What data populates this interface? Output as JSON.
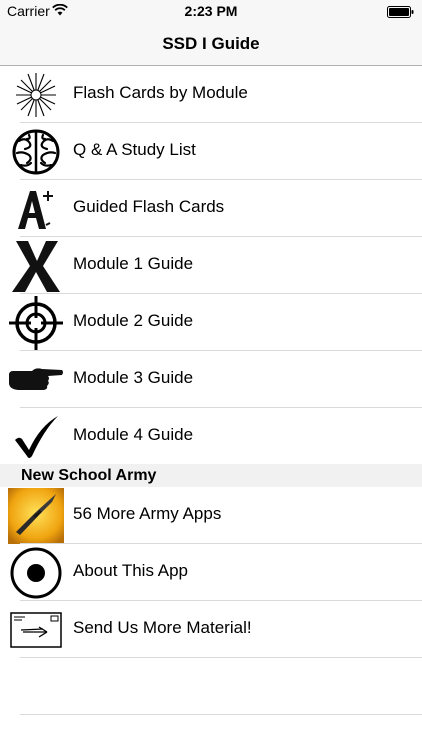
{
  "status_bar": {
    "carrier": "Carrier",
    "time": "2:23 PM"
  },
  "nav": {
    "title": "SSD I Guide"
  },
  "rows_group1": [
    {
      "label": "Flash Cards by Module",
      "icon": "starburst-icon"
    },
    {
      "label": "Q & A Study List",
      "icon": "brain-icon"
    },
    {
      "label": "Guided Flash Cards",
      "icon": "a-plus-icon"
    },
    {
      "label": "Module 1 Guide",
      "icon": "x-mark-icon"
    },
    {
      "label": "Module 2 Guide",
      "icon": "crosshair-icon"
    },
    {
      "label": "Module 3 Guide",
      "icon": "pointing-hand-icon"
    },
    {
      "label": "Module 4 Guide",
      "icon": "checkmark-icon"
    }
  ],
  "section": {
    "title": "New School Army"
  },
  "rows_group2": [
    {
      "label": "56 More Army Apps",
      "icon": "knife-icon"
    },
    {
      "label": "About This App",
      "icon": "circle-dot-icon"
    },
    {
      "label": "Send Us More Material!",
      "icon": "envelope-icon"
    }
  ]
}
